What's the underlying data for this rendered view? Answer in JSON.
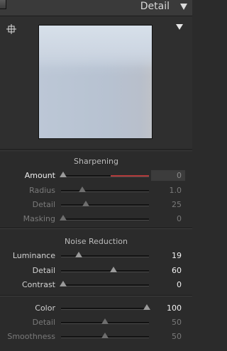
{
  "header": {
    "title": "Detail"
  },
  "preview": {},
  "sharpening": {
    "title": "Sharpening",
    "rows": [
      {
        "label": "Amount",
        "value": "0",
        "level": 0.0,
        "active": true
      },
      {
        "label": "Radius",
        "value": "1.0",
        "level": 0.23,
        "dim": true
      },
      {
        "label": "Detail",
        "value": "25",
        "level": 0.27,
        "dim": true
      },
      {
        "label": "Masking",
        "value": "0",
        "level": 0.0,
        "dim": true
      }
    ]
  },
  "noise_reduction": {
    "title": "Noise Reduction",
    "luminance": [
      {
        "label": "Luminance",
        "value": "19",
        "level": 0.19
      },
      {
        "label": "Detail",
        "value": "60",
        "level": 0.6
      },
      {
        "label": "Contrast",
        "value": "0",
        "level": 0.0
      }
    ],
    "color": [
      {
        "label": "Color",
        "value": "100",
        "level": 1.0
      },
      {
        "label": "Detail",
        "value": "50",
        "level": 0.5,
        "dim": true
      },
      {
        "label": "Smoothness",
        "value": "50",
        "level": 0.5,
        "dim": true
      }
    ]
  },
  "colors": {
    "panel_bg": "#2b2b2b",
    "header_bg": "#3a3a3a",
    "amount_fill": "#b23a3a"
  }
}
